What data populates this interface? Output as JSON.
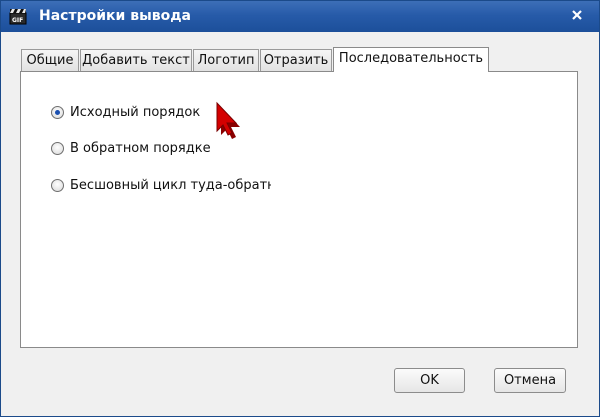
{
  "window": {
    "title": "Настройки вывода",
    "app_icon": "gif-clapper-icon",
    "close_icon": "close-icon"
  },
  "tabs": [
    {
      "label": "Общие",
      "active": false
    },
    {
      "label": "Добавить текст",
      "active": false
    },
    {
      "label": "Логотип",
      "active": false
    },
    {
      "label": "Отразить",
      "active": false
    },
    {
      "label": "Последовательность",
      "active": true
    }
  ],
  "options": [
    {
      "label": "Исходный порядок",
      "checked": true
    },
    {
      "label": "В обратном порядке",
      "checked": false
    },
    {
      "label": "Бесшовный цикл туда-обратно",
      "checked": false
    }
  ],
  "buttons": {
    "ok": "OK",
    "cancel": "Отмена"
  },
  "colors": {
    "titlebar": "#275ba9",
    "radio_dot": "#1a4fb0",
    "cursor": "#d40000"
  }
}
